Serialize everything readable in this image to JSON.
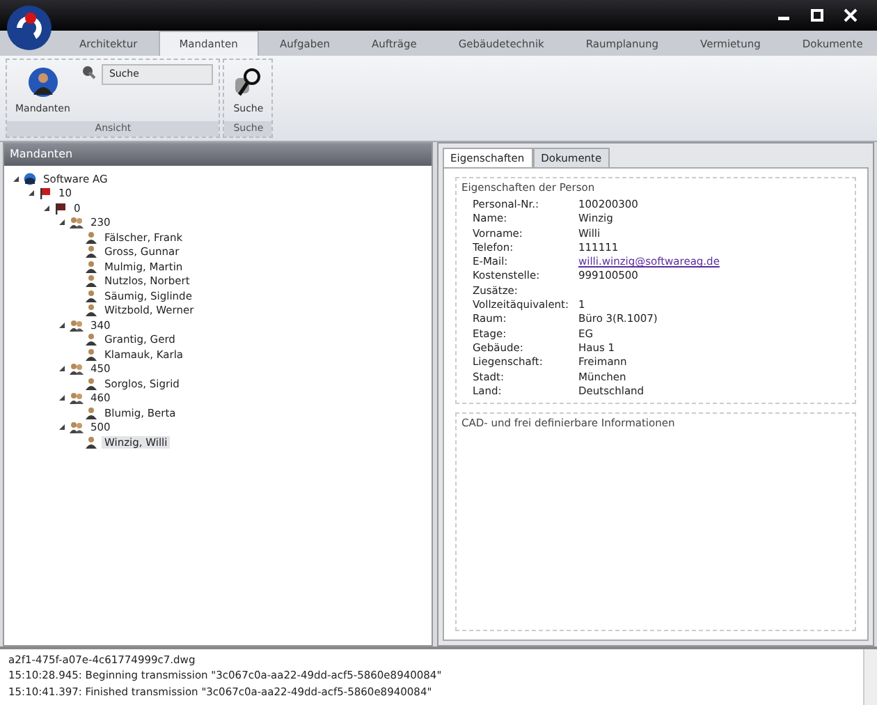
{
  "ribbon_tabs": [
    {
      "label": "Architektur",
      "selected": false
    },
    {
      "label": "Mandanten",
      "selected": true
    },
    {
      "label": "Aufgaben",
      "selected": false
    },
    {
      "label": "Aufträge",
      "selected": false
    },
    {
      "label": "Gebäudetechnik",
      "selected": false
    },
    {
      "label": "Raumplanung",
      "selected": false
    },
    {
      "label": "Vermietung",
      "selected": false
    },
    {
      "label": "Dokumente",
      "selected": false
    }
  ],
  "ribbon_groups": [
    {
      "label": "Ansicht",
      "big_button": "Mandanten",
      "search_value": "Suche"
    },
    {
      "label": "Suche",
      "big_button": "Suche"
    }
  ],
  "tree_panel": {
    "title": "Mandanten",
    "tree": [
      {
        "kind": "company",
        "label": "Software AG",
        "expanded": true,
        "selected": false,
        "children": [
          {
            "kind": "building",
            "label": "10",
            "expanded": true,
            "selected": false,
            "children": [
              {
                "kind": "floor",
                "label": "0",
                "expanded": true,
                "selected": false,
                "children": [
                  {
                    "kind": "group",
                    "label": "230",
                    "expanded": true,
                    "selected": false,
                    "children": [
                      {
                        "kind": "person",
                        "label": "Fälscher, Frank",
                        "selected": false
                      },
                      {
                        "kind": "person",
                        "label": "Gross, Gunnar",
                        "selected": false
                      },
                      {
                        "kind": "person",
                        "label": "Mulmig, Martin",
                        "selected": false
                      },
                      {
                        "kind": "person",
                        "label": "Nutzlos, Norbert",
                        "selected": false
                      },
                      {
                        "kind": "person",
                        "label": "Säumig, Siglinde",
                        "selected": false
                      },
                      {
                        "kind": "person",
                        "label": "Witzbold, Werner",
                        "selected": false
                      }
                    ]
                  },
                  {
                    "kind": "group",
                    "label": "340",
                    "expanded": true,
                    "selected": false,
                    "children": [
                      {
                        "kind": "person",
                        "label": "Grantig, Gerd",
                        "selected": false
                      },
                      {
                        "kind": "person",
                        "label": "Klamauk, Karla",
                        "selected": false
                      }
                    ]
                  },
                  {
                    "kind": "group",
                    "label": "450",
                    "expanded": true,
                    "selected": false,
                    "children": [
                      {
                        "kind": "person",
                        "label": "Sorglos, Sigrid",
                        "selected": false
                      }
                    ]
                  },
                  {
                    "kind": "group",
                    "label": "460",
                    "expanded": true,
                    "selected": false,
                    "children": [
                      {
                        "kind": "person",
                        "label": "Blumig, Berta",
                        "selected": false
                      }
                    ]
                  },
                  {
                    "kind": "group",
                    "label": "500",
                    "expanded": true,
                    "selected": false,
                    "children": [
                      {
                        "kind": "person",
                        "label": "Winzig, Willi",
                        "selected": true
                      }
                    ]
                  }
                ]
              }
            ]
          }
        ]
      }
    ]
  },
  "detail_tabs": [
    {
      "label": "Eigenschaften",
      "selected": true
    },
    {
      "label": "Dokumente",
      "selected": false
    }
  ],
  "person_group": {
    "title": "Eigenschaften der Person",
    "fields": [
      {
        "label": "Personal-Nr.:",
        "value": "100200300"
      },
      {
        "label": "Name:",
        "value": "Winzig"
      },
      {
        "label": "Vorname:",
        "value": "Willi"
      },
      {
        "label": "Telefon:",
        "value": "111111"
      },
      {
        "label": "E-Mail:",
        "value": "willi.winzig@softwareag.de",
        "kind": "link"
      },
      {
        "label": "Kostenstelle:",
        "value": "999100500"
      },
      {
        "label": "Zusätze:"
      },
      {
        "label": "Vollzeitäquivalent:",
        "value": "1"
      },
      {
        "label": "Raum:",
        "value": "Büro 3(R.1007)"
      },
      {
        "label": "Etage:",
        "value": "EG"
      },
      {
        "label": "Gebäude:",
        "value": "Haus 1"
      },
      {
        "label": "Liegenschaft:",
        "value": "Freimann"
      },
      {
        "label": "Stadt:",
        "value": "München"
      },
      {
        "label": "Land:",
        "value": "Deutschland"
      }
    ]
  },
  "cad_group": {
    "title": "CAD- und frei definierbare Informationen"
  },
  "log": [
    "a2f1-475f-a07e-4c61774999c7.dwg",
    "15:10:28.945: Beginning transmission \"3c067c0a-aa22-49dd-acf5-5860e8940084\"",
    "15:10:41.397: Finished transmission \"3c067c0a-aa22-49dd-acf5-5860e8940084\""
  ]
}
